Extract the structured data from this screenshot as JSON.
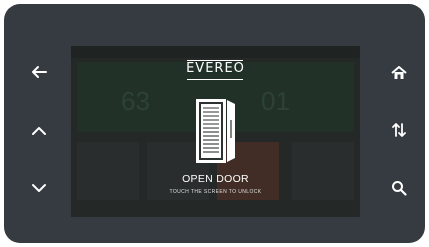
{
  "brand": {
    "name": "EVEREO"
  },
  "overlay": {
    "title": "OPEN DOOR",
    "subtitle": "TOUCH THE SCREEN TO UNLOCK"
  },
  "background_app": {
    "temperature_left": "63",
    "temperature_right": "01"
  },
  "side_buttons": {
    "left": [
      "arrow-left-icon",
      "chevron-up-icon",
      "chevron-down-icon"
    ],
    "right": [
      "home-icon",
      "swap-vertical-icon",
      "search-icon"
    ]
  },
  "colors": {
    "bezel": "#363b41",
    "screen": "#2d3331",
    "text": "#ffffff"
  }
}
